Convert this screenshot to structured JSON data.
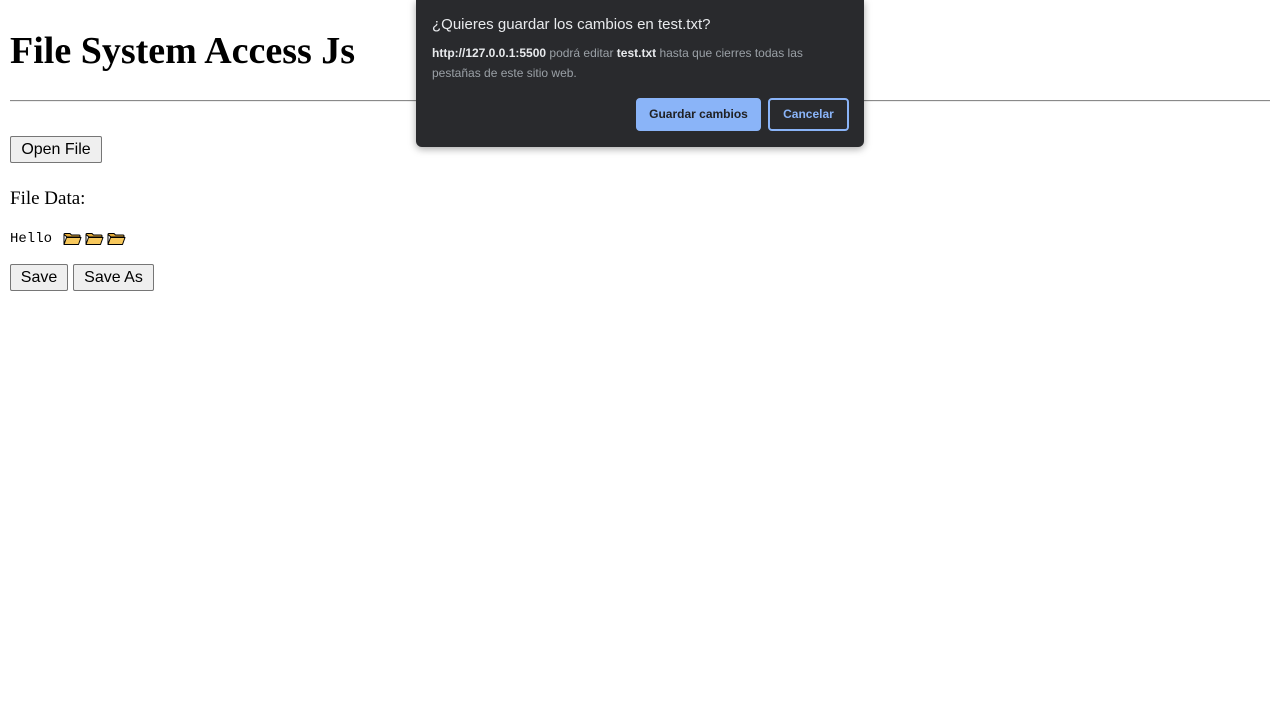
{
  "page": {
    "title": "File System Access Js",
    "open_button": "Open File",
    "file_data_label": "File Data:",
    "file_content_text": "Hello",
    "file_content_icons": [
      "folder-icon",
      "folder-icon",
      "folder-icon"
    ],
    "save_button": "Save",
    "save_as_button": "Save As"
  },
  "dialog": {
    "title": "¿Quieres guardar los cambios en test.txt?",
    "origin": "http://127.0.0.1:5500",
    "text_middle": " podrá editar ",
    "file_name": "test.txt",
    "text_end": " hasta que cierres todas las pestañas de este sitio web.",
    "confirm_button": "Guardar cambios",
    "cancel_button": "Cancelar"
  },
  "colors": {
    "dialog_background": "#292a2d",
    "dialog_accent": "#8ab4f8",
    "dialog_text": "#e8eaed",
    "dialog_muted_text": "#9aa0a6",
    "folder_fill": "#f7c85c"
  }
}
